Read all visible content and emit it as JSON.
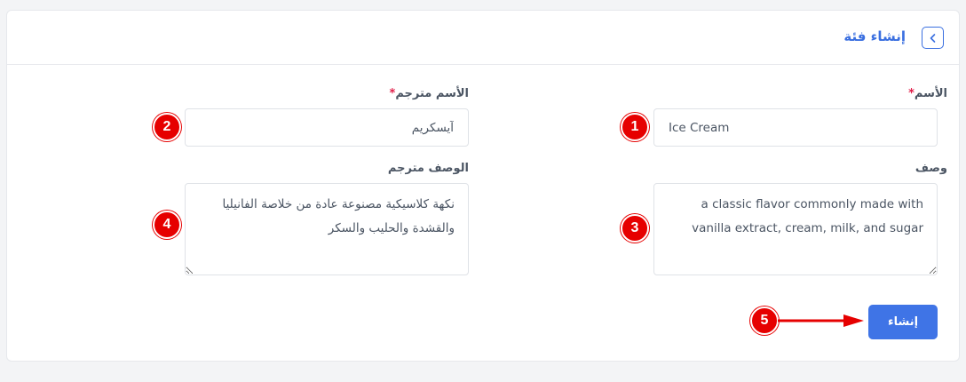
{
  "header": {
    "title": "إنشاء فئة"
  },
  "form": {
    "name": {
      "label": "الأسم",
      "required_mark": "*",
      "value": "Ice Cream"
    },
    "name_translated": {
      "label": "الأسم مترجم",
      "required_mark": "*",
      "value": "آيسكريم"
    },
    "description": {
      "label": "وصف",
      "value": "a classic flavor commonly made with vanilla extract, cream, milk, and sugar"
    },
    "description_translated": {
      "label": "الوصف مترجم",
      "value": "نكهة كلاسيكية مصنوعة عادة من خلاصة الفانيليا والقشدة والحليب والسكر"
    },
    "submit_label": "إنشاء"
  },
  "markers": [
    "1",
    "2",
    "3",
    "4",
    "5"
  ],
  "colors": {
    "accent": "#3f74e6",
    "marker": "#e60000",
    "required": "#e11d48"
  }
}
